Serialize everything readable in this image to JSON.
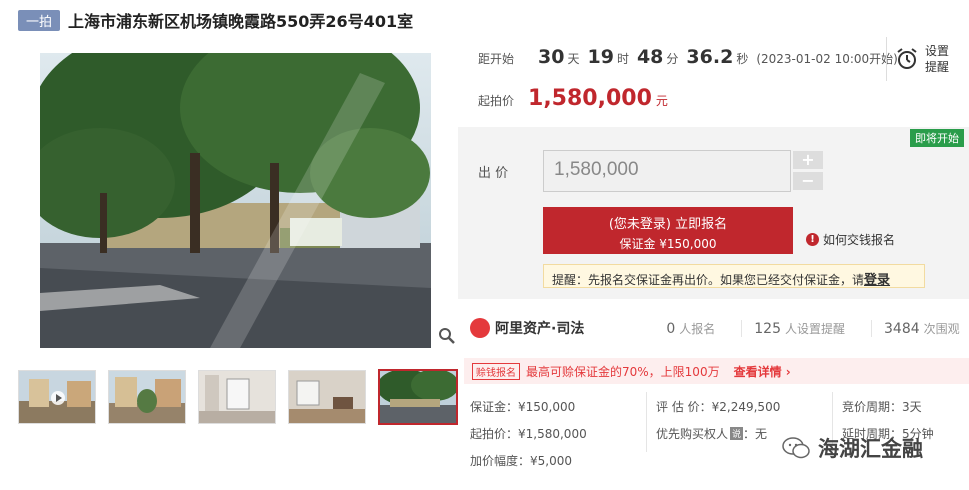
{
  "header": {
    "tag": "一拍",
    "title": "上海市浦东新区机场镇晚霞路550弄26号401室"
  },
  "timer": {
    "label": "距开始",
    "days": "30",
    "days_unit": "天",
    "hours": "19",
    "hours_unit": "时",
    "minutes": "48",
    "minutes_unit": "分",
    "seconds": "36.2",
    "seconds_unit": "秒",
    "start_time": "(2023-01-02 10:00开始)"
  },
  "remind": {
    "label": "设置提醒",
    "icon": "alarm-clock-icon"
  },
  "starting_price": {
    "label": "起拍价",
    "value": "1,580,000",
    "unit": "元"
  },
  "bid": {
    "badge": "即将开始",
    "label": "出 价",
    "input_value": "1,580,000",
    "plus": "+",
    "minus": "−",
    "signup_main": "(您未登录) 立即报名",
    "signup_sub": "保证金 ¥150,000",
    "how_link": "如何交钱报名",
    "notice_prefix": "提醒：先报名交保证金再出价。如果您已经交付保证金，请",
    "notice_login": "登录"
  },
  "stats": {
    "logo": "阿里资产·司法",
    "signups": "0",
    "signups_label": "人报名",
    "reminders": "125",
    "reminders_label": "人设置提醒",
    "views": "3484",
    "views_label": "次围观"
  },
  "promo": {
    "tag": "赊钱报名",
    "text": "最高可赊保证金的70%，上限100万",
    "link": "查看详情 ›"
  },
  "info": {
    "deposit": "保证金：¥150,000",
    "start_price": "起拍价：¥1,580,000",
    "increment": "加价幅度：¥5,000",
    "valuation": "评 估 价：¥2,249,500",
    "priority_label": "优先购买权人",
    "priority_badge": "说",
    "priority_value": "：无",
    "bid_period": "竞价周期：3天",
    "delay_period": "延时周期：5分钟"
  },
  "watermark": {
    "text": "海湖汇金融"
  },
  "colors": {
    "accent": "#c0272d",
    "tag": "#7a8fb8",
    "green": "#2a9d4b"
  }
}
